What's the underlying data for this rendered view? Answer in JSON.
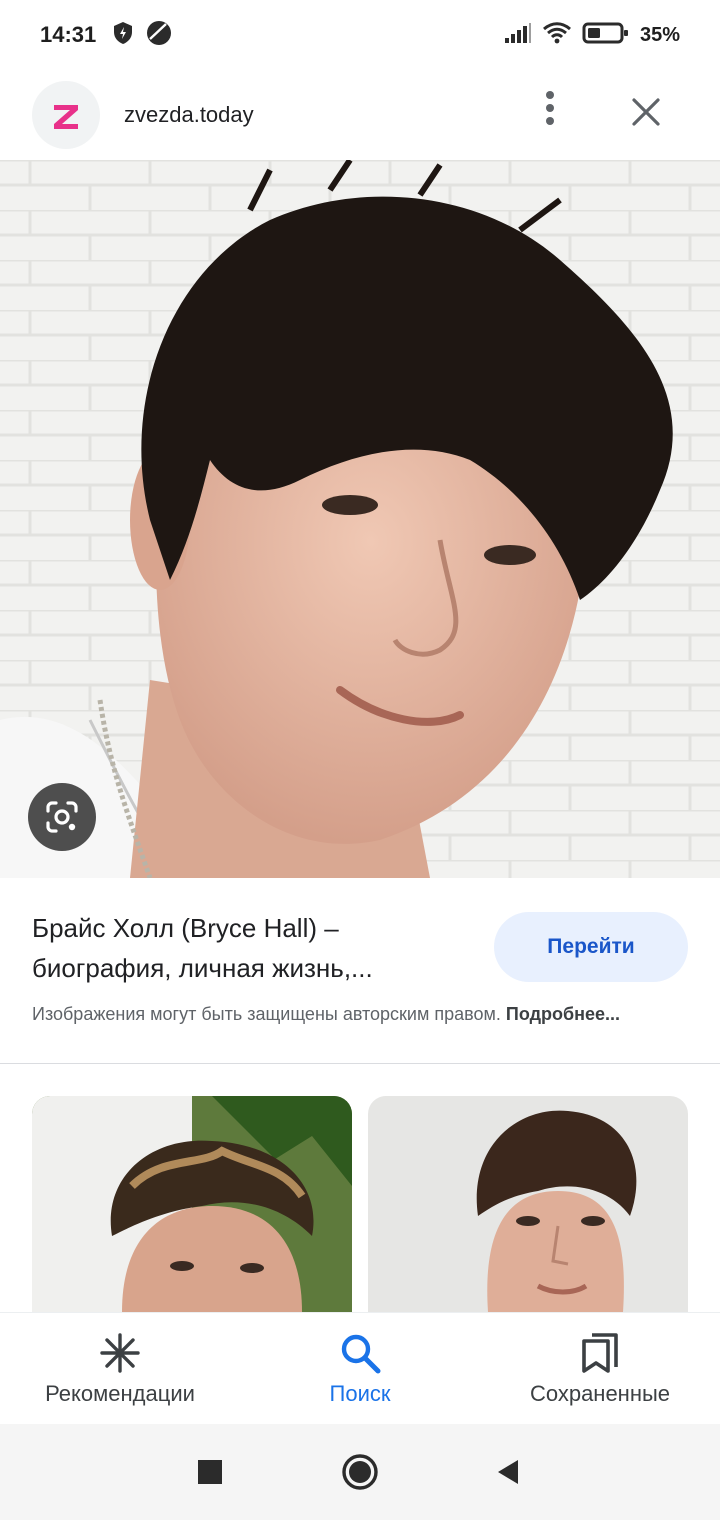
{
  "status": {
    "time": "14:31",
    "battery": "35%",
    "icons": [
      "shield-icon",
      "vpn-icon",
      "signal-icon",
      "wifi-icon",
      "battery-icon"
    ]
  },
  "header": {
    "favicon_letter": "z",
    "site": "zvezda.today",
    "menu_icon": "more-vert-icon",
    "close_icon": "close-icon"
  },
  "result": {
    "title": "Брайс Холл (Bryce Hall) – биография, личная жизнь,...",
    "visit_label": "Перейти",
    "copyright": "Изображения могут быть защищены авторским правом.",
    "more_label": "Подробнее..."
  },
  "nav": {
    "items": [
      {
        "label": "Рекомендации",
        "icon": "asterisk-icon"
      },
      {
        "label": "Поиск",
        "icon": "search-icon"
      },
      {
        "label": "Сохраненные",
        "icon": "bookmarks-icon"
      }
    ],
    "active": "Поиск"
  },
  "colors": {
    "accent": "#1a73e8",
    "button_bg": "#e8f0fe",
    "favicon": "#e8318a"
  }
}
